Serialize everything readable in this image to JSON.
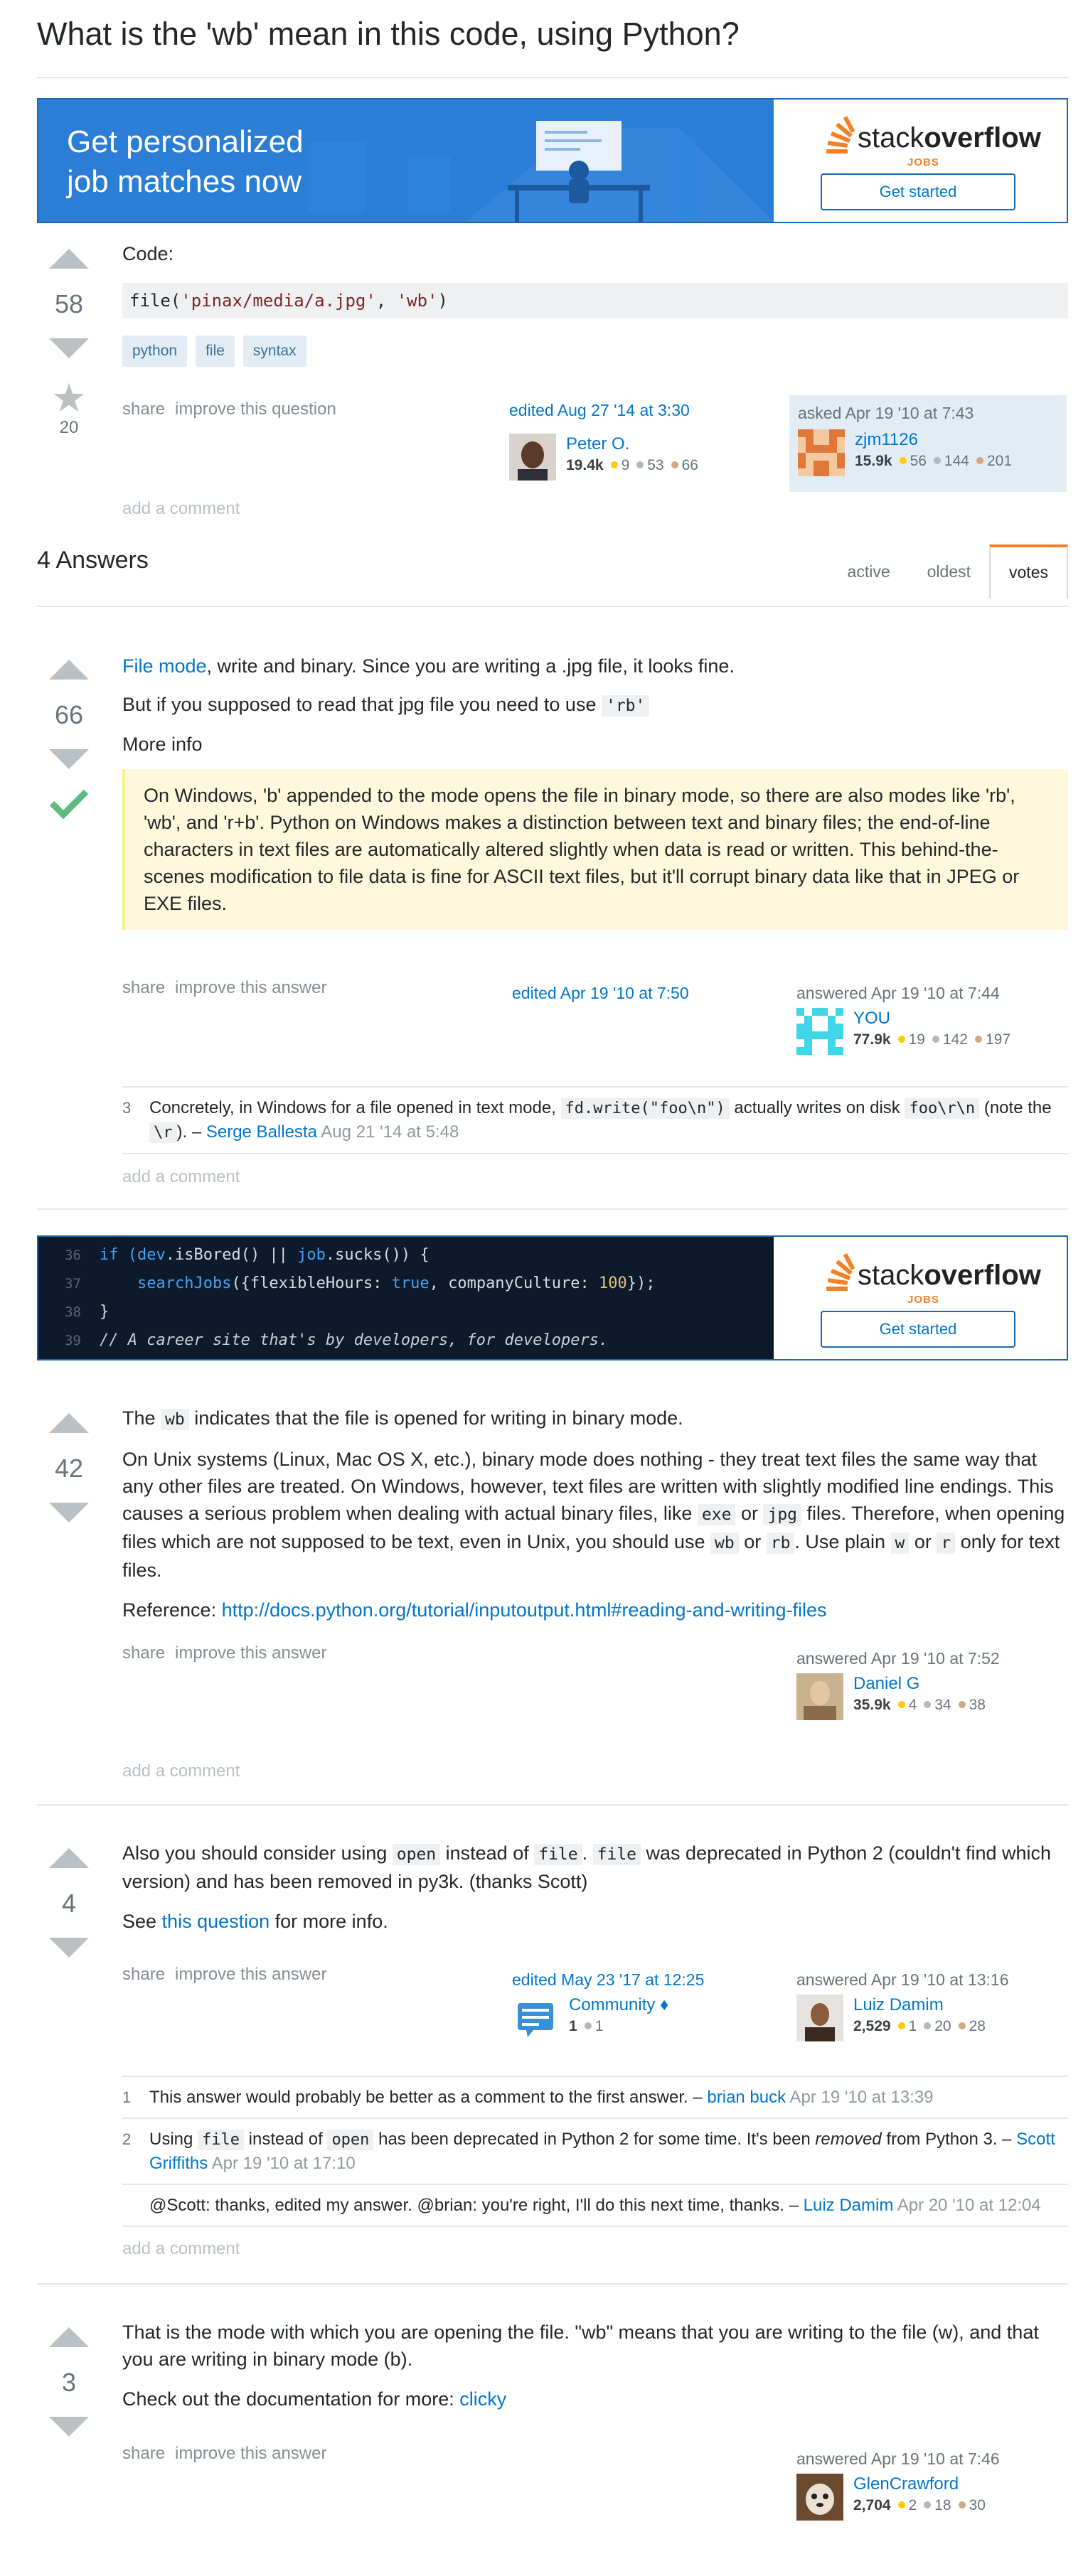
{
  "question": {
    "title": "What is the 'wb' mean in this code, using Python?",
    "votes": "58",
    "favorites": "20",
    "intro": "Code:",
    "code_fn": "file(",
    "code_arg1": "'pinax/media/a.jpg'",
    "code_sep": ", ",
    "code_arg2": "'wb'",
    "code_end": ")",
    "tags": [
      "python",
      "file",
      "syntax"
    ],
    "menu": {
      "share": "share",
      "improve": "improve this question"
    },
    "edited": {
      "action": "edited Aug 27 '14 at 3:30",
      "user": "Peter O.",
      "rep": "19.4k",
      "gold": "9",
      "silver": "53",
      "bronze": "66"
    },
    "asked": {
      "action": "asked Apr 19 '10 at 7:43",
      "user": "zjm1126",
      "rep": "15.9k",
      "gold": "56",
      "silver": "144",
      "bronze": "201"
    },
    "add_comment": "add a comment"
  },
  "ad1": {
    "headline_1": "Get personalized",
    "headline_2": "job matches now",
    "logo_light": "stack",
    "logo_bold": "overflow",
    "logo_jobs": "JOBS",
    "button": "Get started"
  },
  "ad2": {
    "lines": [
      {
        "n": "36",
        "t1": "if (",
        "k1": "dev",
        "t2": ".isBored() || ",
        "k2": "job",
        "t3": ".sucks()) {"
      },
      {
        "n": "37",
        "k1": "searchJobs",
        "t1": "({flexibleHours: ",
        "k2": "true",
        "t2": ", companyCulture: ",
        "num": "100",
        "t3": "});"
      },
      {
        "n": "38",
        "t1": "}"
      },
      {
        "n": "39",
        "cm": "// A career site that's by developers, for developers."
      }
    ],
    "logo_light": "stack",
    "logo_bold": "overflow",
    "logo_jobs": "JOBS",
    "button": "Get started"
  },
  "answers_header": {
    "count": "4 Answers",
    "tabs": [
      "active",
      "oldest",
      "votes"
    ]
  },
  "answer1": {
    "votes": "66",
    "p1_link": "File mode",
    "p1_rest": ", write and binary. Since you are writing a .jpg file, it looks fine.",
    "p2": "But if you supposed to read that jpg file you need to use ",
    "p2_code": "'rb'",
    "p3": "More info",
    "quote": "On Windows, 'b' appended to the mode opens the file in binary mode, so there are also modes like 'rb', 'wb', and 'r+b'. Python on Windows makes a distinction between text and binary files; the end-of-line characters in text files are automatically altered slightly when data is read or written. This behind-the-scenes modification to file data is fine for ASCII text files, but it'll corrupt binary data like that in JPEG or EXE files.",
    "menu": {
      "share": "share",
      "improve": "improve this answer"
    },
    "edited": "edited Apr 19 '10 at 7:50",
    "answered": {
      "action": "answered Apr 19 '10 at 7:44",
      "user": "YOU",
      "rep": "77.9k",
      "gold": "19",
      "silver": "142",
      "bronze": "197"
    },
    "comment": {
      "score": "3",
      "t1": "Concretely, in Windows for a file opened in text mode, ",
      "c1": "fd.write(\"foo\\n\")",
      "t2": " actually writes on disk ",
      "c2": "foo\\r\\n",
      "t3": " (note the ",
      "c3": "\\r",
      "t4": "). – ",
      "user": "Serge Ballesta",
      "time": " Aug 21 '14 at 5:48"
    },
    "add_comment": "add a comment"
  },
  "answer2": {
    "votes": "42",
    "p1a": "The ",
    "p1_code": "wb",
    "p1b": " indicates that the file is opened for writing in binary mode.",
    "p2a": "On Unix systems (Linux, Mac OS X, etc.), binary mode does nothing - they treat text files the same way that any other files are treated. On Windows, however, text files are written with slightly modified line endings. This causes a serious problem when dealing with actual binary files, like ",
    "p2_c1": "exe",
    "p2b": " or ",
    "p2_c2": "jpg",
    "p2c": " files. Therefore, when opening files which are not supposed to be text, even in Unix, you should use ",
    "p2_c3": "wb",
    "p2d": " or ",
    "p2_c4": "rb",
    "p2e": ". Use plain ",
    "p2_c5": "w",
    "p2f": " or ",
    "p2_c6": "r",
    "p2g": " only for text files.",
    "p3": "Reference: ",
    "p3_link": "http://docs.python.org/tutorial/inputoutput.html#reading-and-writing-files",
    "menu": {
      "share": "share",
      "improve": "improve this answer"
    },
    "answered": {
      "action": "answered Apr 19 '10 at 7:52",
      "user": "Daniel G",
      "rep": "35.9k",
      "gold": "4",
      "silver": "34",
      "bronze": "38"
    },
    "add_comment": "add a comment"
  },
  "answer3": {
    "votes": "4",
    "p1a": "Also you should consider using ",
    "p1_c1": "open",
    "p1b": " instead of ",
    "p1_c2": "file",
    "p1c": ". ",
    "p1_c3": "file",
    "p1d": " was deprecated in Python 2 (couldn't find which version) and has been removed in py3k. (thanks Scott)",
    "p2a": "See ",
    "p2_link": "this question",
    "p2b": " for more info.",
    "menu": {
      "share": "share",
      "improve": "improve this answer"
    },
    "edited": {
      "action": "edited May 23 '17 at 12:25",
      "user": "Community ♦",
      "rep": "1",
      "silver": "1"
    },
    "answered": {
      "action": "answered Apr 19 '10 at 13:16",
      "user": "Luiz Damim",
      "rep": "2,529",
      "gold": "1",
      "silver": "20",
      "bronze": "28"
    },
    "comments": [
      {
        "score": "1",
        "t1": "This answer would probably be better as a comment to the first answer. – ",
        "user": "brian buck",
        "time": " Apr 19 '10 at 13:39"
      },
      {
        "score": "2",
        "t1": "Using ",
        "c1": "file",
        "t2": " instead of ",
        "c2": "open",
        "t3": " has been deprecated in Python 2 for some time. It's been ",
        "em": "removed",
        "t4": " from Python 3. – ",
        "user": "Scott Griffiths",
        "time": " Apr 19 '10 at 17:10"
      },
      {
        "score": "",
        "t1": "@Scott: thanks, edited my answer. @brian: you're right, I'll do this next time, thanks. – ",
        "user": "Luiz Damim",
        "time": " Apr 20 '10 at 12:04"
      }
    ],
    "add_comment": "add a comment"
  },
  "answer4": {
    "votes": "3",
    "p1": "That is the mode with which you are opening the file. \"wb\" means that you are writing to the file (w), and that you are writing in binary mode (b).",
    "p2a": "Check out the documentation for more: ",
    "p2_link": "clicky",
    "menu": {
      "share": "share",
      "improve": "improve this answer"
    },
    "answered": {
      "action": "answered Apr 19 '10 at 7:46",
      "user": "GlenCrawford",
      "rep": "2,704",
      "gold": "2",
      "silver": "18",
      "bronze": "30"
    }
  },
  "colors": {
    "accent": "#0077cc",
    "orange": "#f48024",
    "tag_bg": "#e1ecf4",
    "check": "#5eba7d"
  }
}
